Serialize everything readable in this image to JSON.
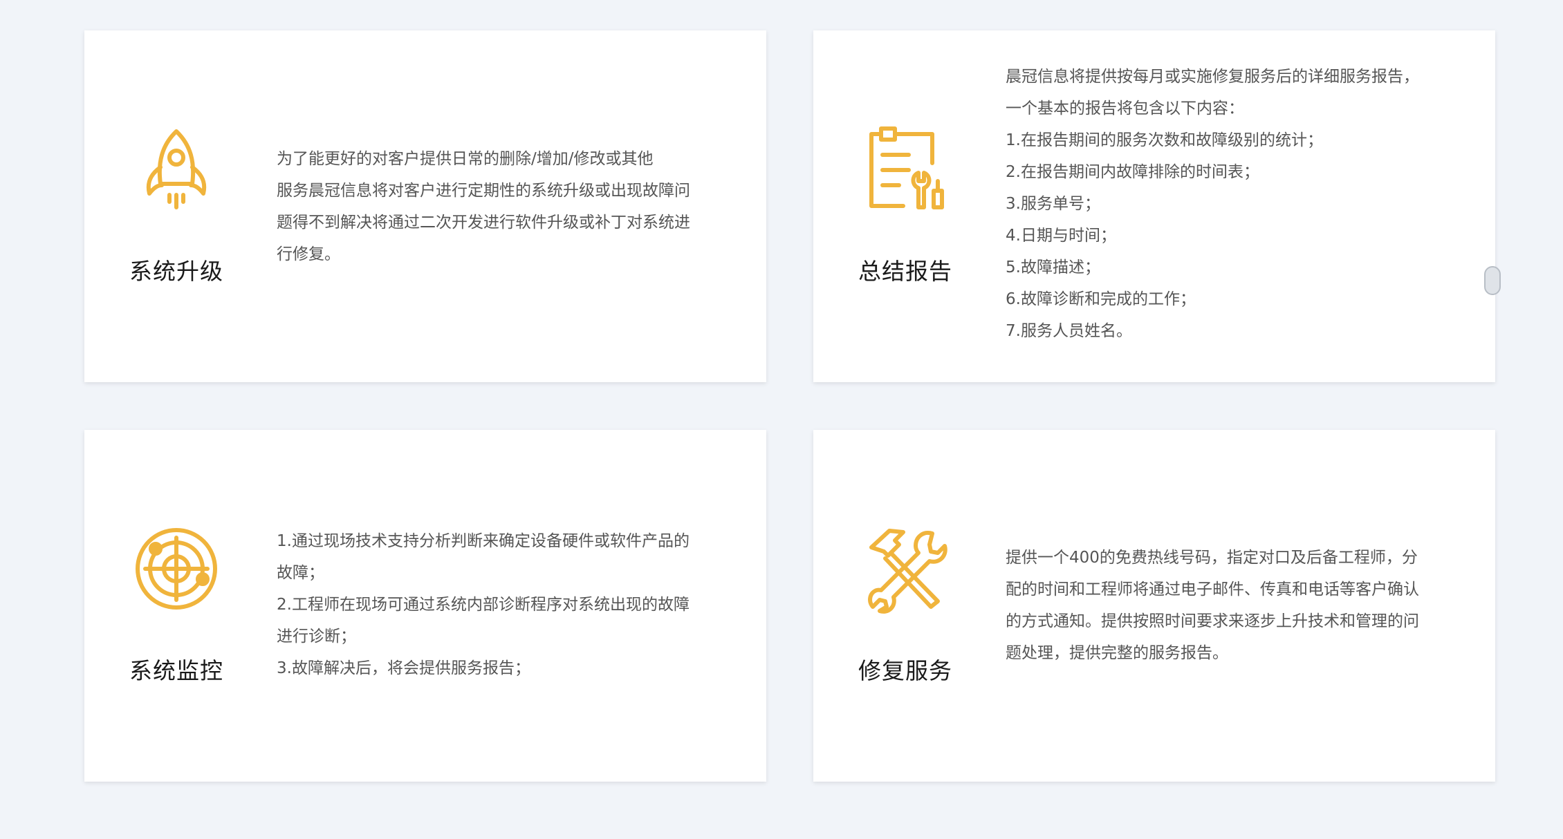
{
  "accent_color": "#f0b43c",
  "cards": [
    {
      "title": "系统升级",
      "icon": "rocket-icon",
      "lines": [
        "为了能更好的对客户提供日常的删除/增加/修改或其他",
        "服务晨冠信息将对客户进行定期性的系统升级或出现故障问",
        "题得不到解决将通过二次开发进行软件升级或补丁对系统进",
        "行修复。"
      ]
    },
    {
      "title": "总结报告",
      "icon": "report-clipboard-icon",
      "lines": [
        "晨冠信息将提供按每月或实施修复服务后的详细服务报告，",
        "一个基本的报告将包含以下内容：",
        "1.在报告期间的服务次数和故障级别的统计；",
        "2.在报告期间内故障排除的时间表；",
        "3.服务单号；",
        "4.日期与时间；",
        "5.故障描述；",
        "6.故障诊断和完成的工作；",
        "7.服务人员姓名。"
      ]
    },
    {
      "title": "系统监控",
      "icon": "radar-target-icon",
      "lines": [
        "1.通过现场技术支持分析判断来确定设备硬件或软件产品的",
        "故障；",
        "2.工程师在现场可通过系统内部诊断程序对系统出现的故障",
        "进行诊断；",
        "3.故障解决后，将会提供服务报告；"
      ]
    },
    {
      "title": "修复服务",
      "icon": "hammer-wrench-icon",
      "lines": [
        "提供一个400的免费热线号码，指定对口及后备工程师，分",
        "配的时间和工程师将通过电子邮件、传真和电话等客户确认",
        "的方式通知。提供按照时间要求来逐步上升技术和管理的问",
        "题处理，提供完整的服务报告。"
      ]
    }
  ]
}
